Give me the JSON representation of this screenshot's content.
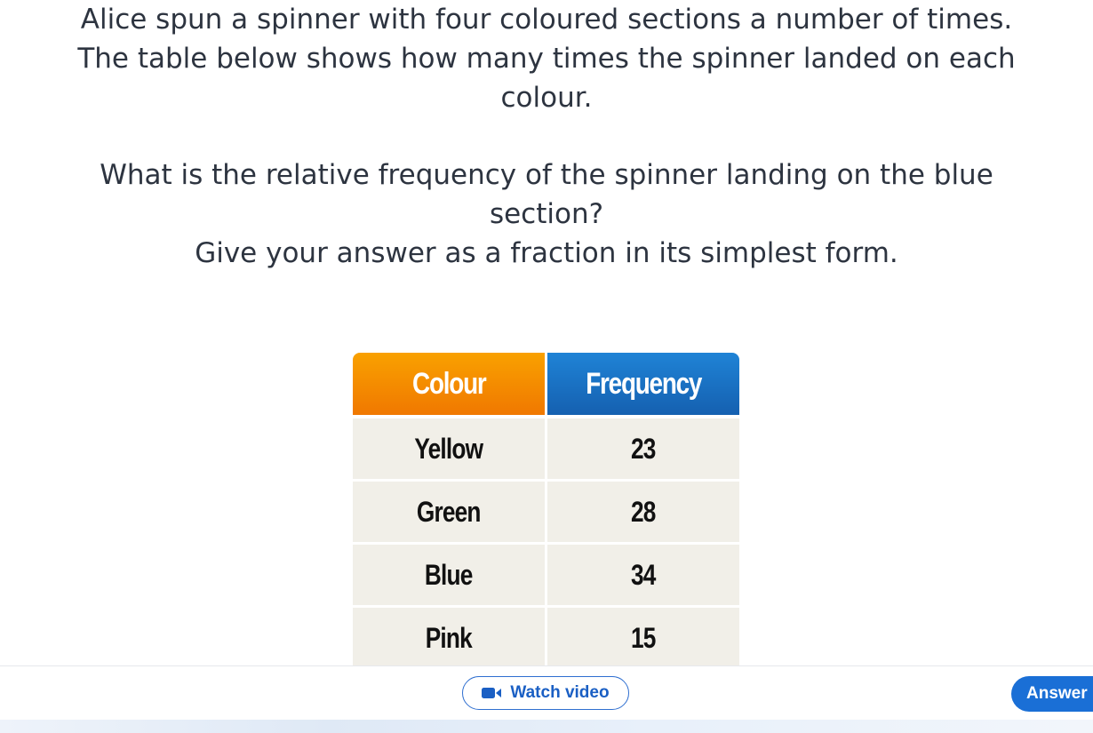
{
  "question": {
    "line1": "Alice spun a spinner with four coloured sections a number of times.",
    "line2": "The table below shows how many times the spinner landed on each",
    "line3": "colour.",
    "line4": "What is the relative frequency of the spinner landing on the blue",
    "line5": "section?",
    "line6": "Give your answer as a fraction in its simplest form."
  },
  "table": {
    "headers": [
      "Colour",
      "Frequency"
    ],
    "rows": [
      [
        "Yellow",
        "23"
      ],
      [
        "Green",
        "28"
      ],
      [
        "Blue",
        "34"
      ],
      [
        "Pink",
        "15"
      ]
    ],
    "header_colors": [
      "#f28a00",
      "#1a6fc8"
    ]
  },
  "footer": {
    "watch_video_label": "Watch video",
    "answer_label": "Answer"
  },
  "icons": {
    "watch_video": "video-camera-icon"
  }
}
